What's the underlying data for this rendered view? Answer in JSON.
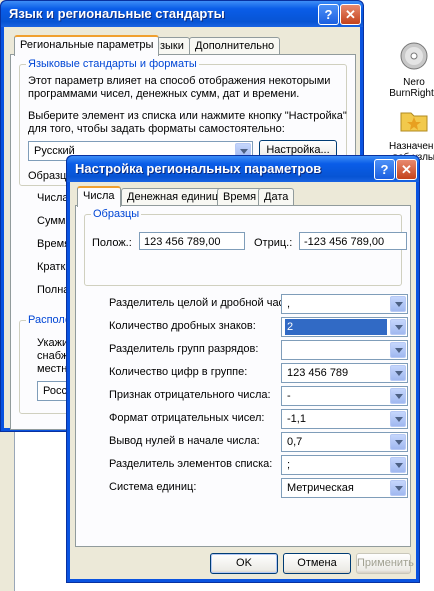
{
  "desktop": {
    "icons": [
      {
        "label": "Nero BurnRights",
        "icon": "nero-disc-icon"
      },
      {
        "label": "Назначенн веб-узлы",
        "icon": "folder-star-icon"
      }
    ]
  },
  "back_window": {
    "title": "Язык и региональные стандарты",
    "help_btn": "?",
    "close_btn": "✕",
    "tabs": [
      "Региональные параметры",
      "Языки",
      "Дополнительно"
    ],
    "group1": {
      "title": "Языковые стандарты и форматы",
      "desc1": "Этот параметр влияет на способ отображения некоторыми",
      "desc2": "программами чисел, денежных сумм, дат и времени.",
      "instr1": "Выберите элемент из списка или нажмите кнопку \"Настройка\"",
      "instr2": "для того, чтобы задать форматы самостоятельно:",
      "locale_value": "Русский",
      "customize_btn": "Настройка..."
    },
    "samples_label": "Образц",
    "sample_rows": [
      "Числа:",
      "Сумма",
      "Время",
      "Кратка",
      "Полная"
    ],
    "group2": {
      "title": "Располо",
      "text1": "Укажит",
      "text2": "снабжа",
      "text3": "местны",
      "location_value": "Россия"
    }
  },
  "dialog": {
    "title": "Настройка региональных параметров",
    "help_btn": "?",
    "close_btn": "✕",
    "tabs": [
      "Числа",
      "Денежная единица",
      "Время",
      "Дата"
    ],
    "samples": {
      "title": "Образцы",
      "positive_label": "Полож.:",
      "positive_value": "123 456 789,00",
      "negative_label": "Отриц.:",
      "negative_value": "-123 456 789,00"
    },
    "settings": [
      {
        "label": "Разделитель целой и дробной части:",
        "value": ","
      },
      {
        "label": "Количество дробных знаков:",
        "value": "2"
      },
      {
        "label": "Разделитель групп разрядов:",
        "value": ""
      },
      {
        "label": "Количество цифр в группе:",
        "value": "123 456 789"
      },
      {
        "label": "Признак отрицательного числа:",
        "value": "-"
      },
      {
        "label": "Формат отрицательных чисел:",
        "value": "-1,1"
      },
      {
        "label": "Вывод нулей в начале числа:",
        "value": "0,7"
      },
      {
        "label": "Разделитель элементов списка:",
        "value": ";"
      },
      {
        "label": "Система единиц:",
        "value": "Метрическая"
      }
    ],
    "buttons": {
      "ok": "OK",
      "cancel": "Отмена",
      "apply": "Применить"
    }
  },
  "colors": {
    "xp_blue": "#0a5de8",
    "selection": "#316ac5",
    "group_title": "#0046d5"
  }
}
